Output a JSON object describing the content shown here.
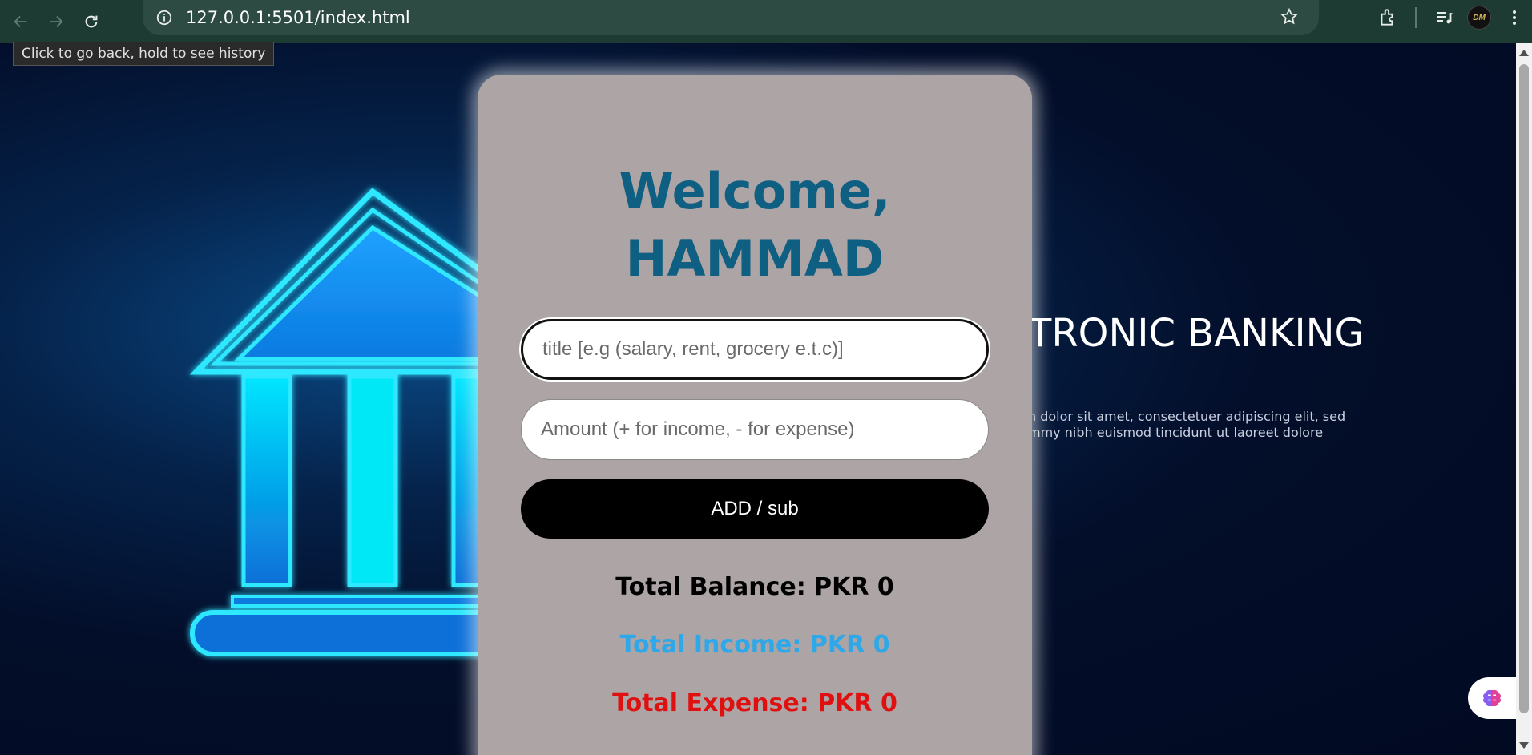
{
  "browser": {
    "url": "127.0.0.1:5501/index.html",
    "tooltip": "Click to go back, hold to see history",
    "avatar_text": "DM"
  },
  "banner": {
    "title": "TRONIC BANKING",
    "subtitle_line1": "n dolor sit amet, consectetuer adipiscing elit, sed",
    "subtitle_line2": "mmy nibh euismod tincidunt ut laoreet dolore"
  },
  "card": {
    "welcome_line1": "Welcome,",
    "welcome_line2": "HAMMAD",
    "title_placeholder": "title [e.g (salary, rent, grocery e.t.c)]",
    "amount_placeholder": "Amount (+ for income, - for expense)",
    "add_button_label": "ADD / sub",
    "total_balance": "Total Balance: PKR 0",
    "total_income": "Total Income: PKR 0",
    "total_expense": "Total Expense: PKR 0"
  },
  "colors": {
    "card_bg": "#aca4a5",
    "welcome": "#0f5f82",
    "income": "#2ea8e8",
    "expense": "#e01010",
    "button_bg": "#000000"
  }
}
